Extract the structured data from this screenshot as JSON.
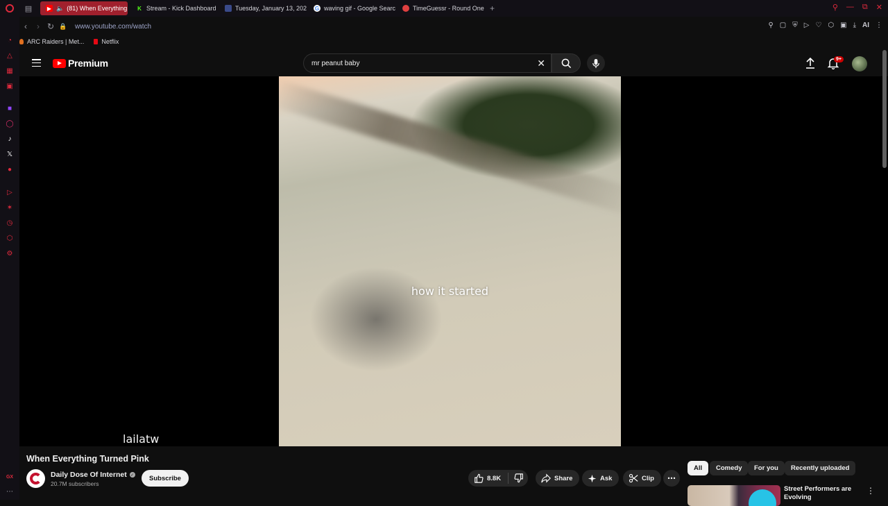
{
  "browser": {
    "tabs": [
      {
        "label": "(81) When Everything",
        "active": true,
        "icon": "youtube-favicon",
        "color": "#ff0000"
      },
      {
        "label": "Stream - Kick Dashboard",
        "active": false,
        "icon": "kick-favicon",
        "color": "#53fc18"
      },
      {
        "label": "Tuesday, January 13, 202",
        "active": false,
        "icon": "calendar-favicon",
        "color": "#6a8cff"
      },
      {
        "label": "waving gif - Google Searc",
        "active": false,
        "icon": "google-favicon",
        "color": "#ffffff"
      },
      {
        "label": "TimeGuessr - Round One",
        "active": false,
        "icon": "timeguessr-favicon",
        "color": "#e04040"
      }
    ],
    "url": "www.youtube.com/watch",
    "bookmarks": [
      {
        "label": "ARC Raiders | Met...",
        "icon": "flame-icon"
      },
      {
        "label": "Netflix",
        "icon": "netflix-icon"
      }
    ],
    "accent": "#e02a3d",
    "ai_label": "AI",
    "sidebar_bottom_label": "GX"
  },
  "youtube": {
    "brand": "Premium",
    "search_query": "mr peanut baby",
    "notification_badge": "9+",
    "video": {
      "caption": "how it started",
      "watermark": "lailatw",
      "title": "When Everything Turned Pink"
    },
    "channel": {
      "name": "Daily Dose Of Internet",
      "subscribers": "20.7M subscribers",
      "subscribe_label": "Subscribe"
    },
    "actions": {
      "likes": "8.8K",
      "share": "Share",
      "ask": "Ask",
      "clip": "Clip"
    },
    "chips": [
      "All",
      "Comedy",
      "For you",
      "Recently uploaded"
    ],
    "recommendation": {
      "title": "Street Performers are Evolving"
    }
  }
}
